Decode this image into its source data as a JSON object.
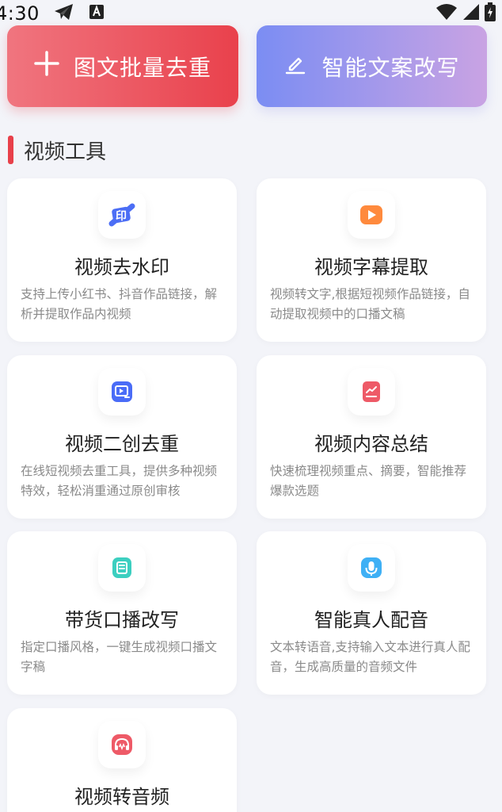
{
  "status_bar": {
    "time": "4:30",
    "icons": [
      "telegram-icon",
      "font-a-icon",
      "wifi-icon",
      "signal-icon",
      "battery-charging-icon"
    ]
  },
  "top_actions": {
    "dedupe": {
      "label": "图文批量去重",
      "icon": "plus-icon"
    },
    "rewrite": {
      "label": "智能文案改写",
      "icon": "pen-icon"
    }
  },
  "section": {
    "title": "视频工具",
    "accent": "#e8404a"
  },
  "tools": [
    {
      "title": "视频去水印",
      "desc": "支持上传小红书、抖音作品链接，解析并提取作品内视频",
      "icon": "watermark-stamp-icon",
      "color": "#4c6ef5"
    },
    {
      "title": "视频字幕提取",
      "desc": "视频转文字,根据短视频作品链接，自动提取视频中的口播文稿",
      "icon": "play-icon",
      "color": "#ff8a3d"
    },
    {
      "title": "视频二创去重",
      "desc": "在线短视频去重工具，提供多种视频特效，轻松消重通过原创审核",
      "icon": "video-edit-icon",
      "color": "#4a6cf7"
    },
    {
      "title": "视频内容总结",
      "desc": "快速梳理视频重点、摘要，智能推荐爆款选题",
      "icon": "summary-chart-icon",
      "color": "#ee5a67"
    },
    {
      "title": "带货口播改写",
      "desc": "指定口播风格，一键生成视频口播文字稿",
      "icon": "document-icon",
      "color": "#3ccfc0"
    },
    {
      "title": "智能真人配音",
      "desc": "文本转语音,支持输入文本进行真人配音，生成高质量的音频文件",
      "icon": "microphone-icon",
      "color": "#3fb0f5"
    },
    {
      "title": "视频转音频",
      "desc": "",
      "icon": "headphones-icon",
      "color": "#ee5a67"
    }
  ]
}
